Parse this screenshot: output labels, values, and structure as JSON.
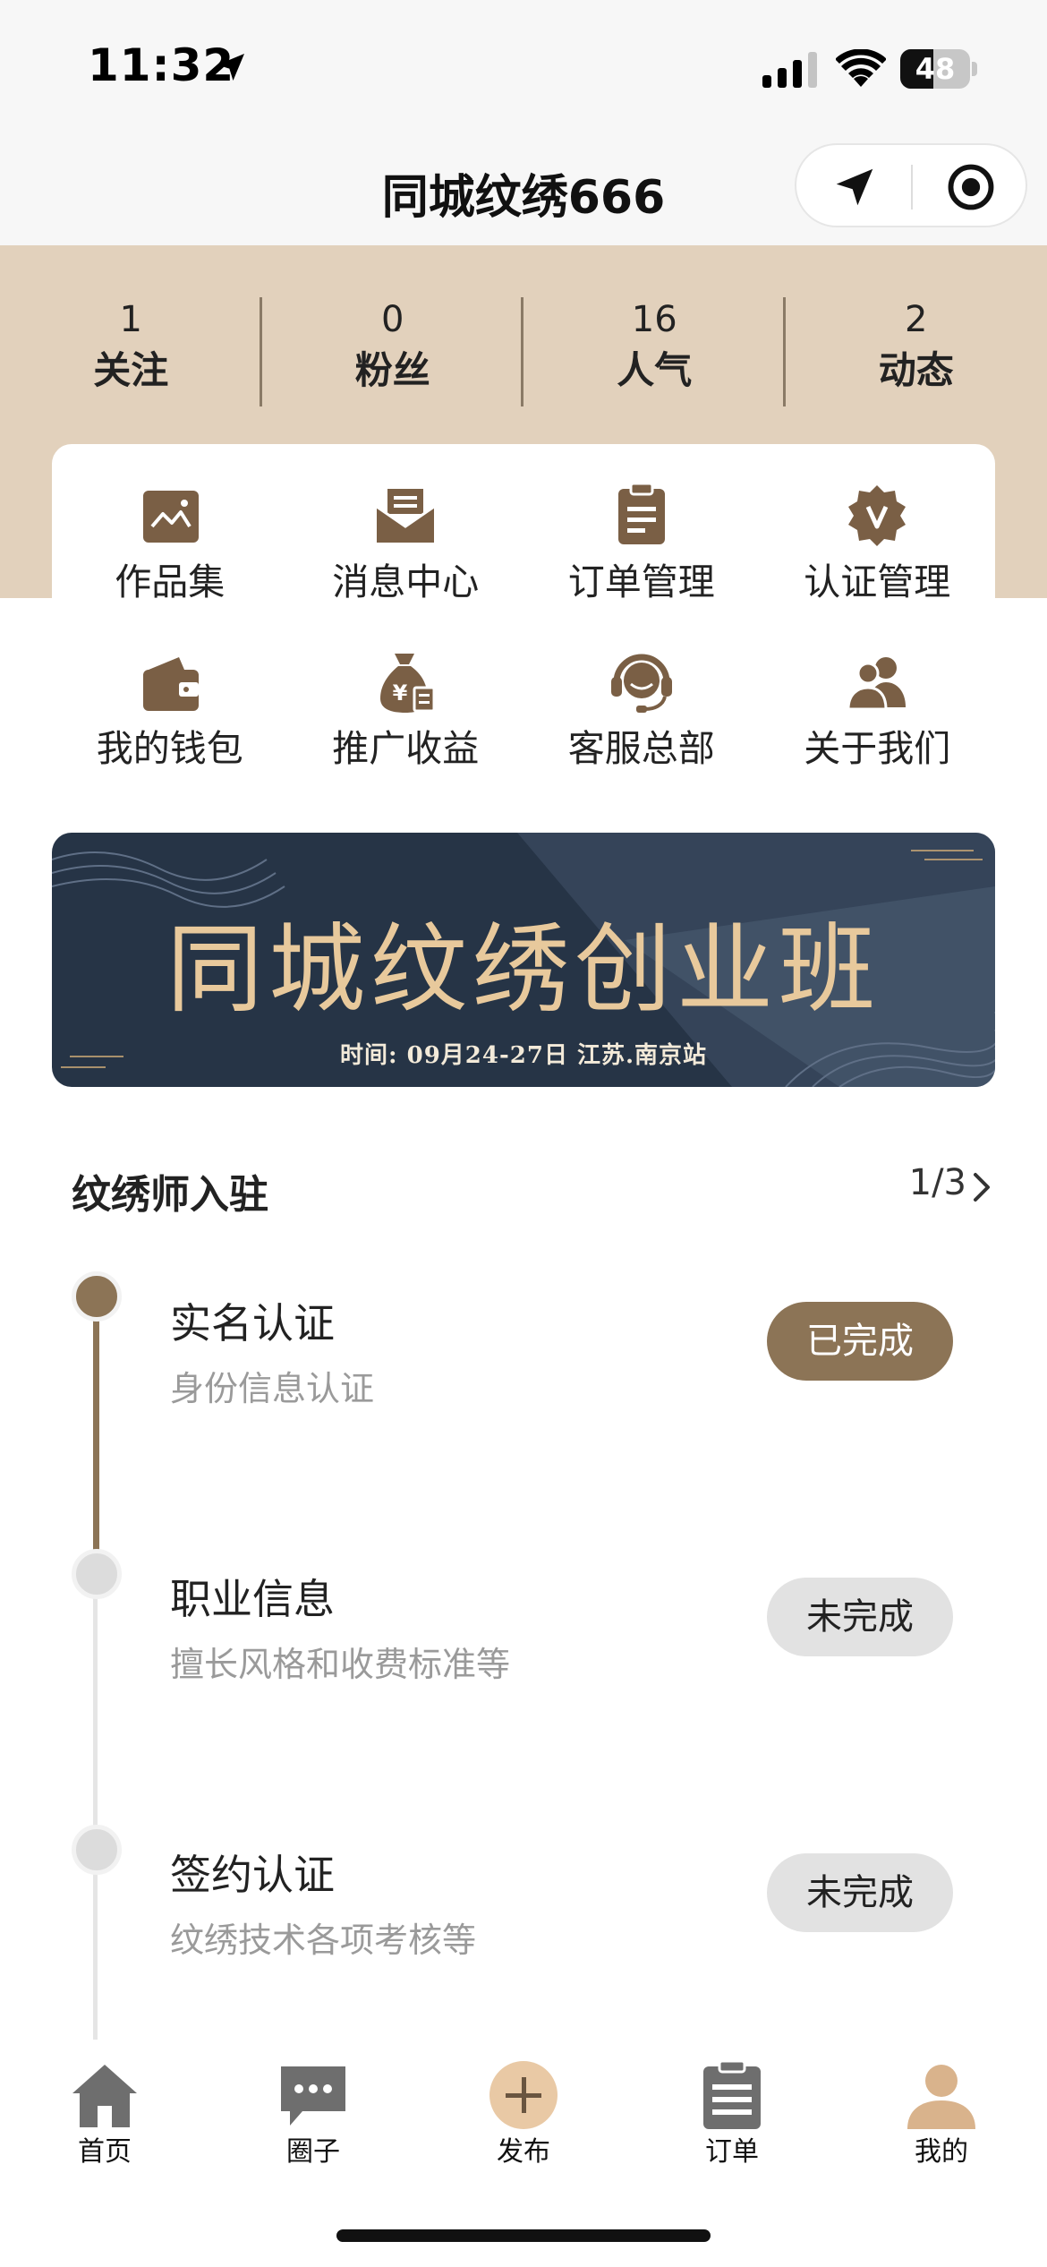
{
  "status_bar": {
    "time": "11:32",
    "battery": "48",
    "battery_level": 0.48,
    "icons": [
      "location-arrow-icon",
      "signal-icon",
      "wifi-icon",
      "battery-icon"
    ]
  },
  "nav": {
    "title": "同城纹绣666",
    "capsule_icons": [
      "navigation-arrow-icon",
      "target-circle-icon"
    ]
  },
  "stats": [
    {
      "count": "1",
      "label": "关注"
    },
    {
      "count": "0",
      "label": "粉丝"
    },
    {
      "count": "16",
      "label": "人气"
    },
    {
      "count": "2",
      "label": "动态"
    }
  ],
  "menu": [
    {
      "label": "作品集",
      "icon": "image-gallery-icon"
    },
    {
      "label": "消息中心",
      "icon": "envelope-icon"
    },
    {
      "label": "订单管理",
      "icon": "clipboard-icon"
    },
    {
      "label": "认证管理",
      "icon": "verified-badge-icon"
    },
    {
      "label": "我的钱包",
      "icon": "wallet-icon"
    },
    {
      "label": "推广收益",
      "icon": "money-bag-icon"
    },
    {
      "label": "客服总部",
      "icon": "headset-icon"
    },
    {
      "label": "关于我们",
      "icon": "users-icon"
    }
  ],
  "banner": {
    "title": "同城纹绣创业班",
    "subtitle": "时间: 09月24-27日  江苏.南京站"
  },
  "onboarding": {
    "title": "纹绣师入驻",
    "page": "1/3",
    "steps": [
      {
        "title": "实名认证",
        "desc": "身份信息认证",
        "status": "已完成",
        "done": true
      },
      {
        "title": "职业信息",
        "desc": "擅长风格和收费标准等",
        "status": "未完成",
        "done": false
      },
      {
        "title": "签约认证",
        "desc": "纹绣技术各项考核等",
        "status": "未完成",
        "done": false
      }
    ]
  },
  "tabs": [
    {
      "label": "首页",
      "icon": "home-icon"
    },
    {
      "label": "圈子",
      "icon": "chat-bubble-icon"
    },
    {
      "label": "发布",
      "icon": "plus-circle-icon"
    },
    {
      "label": "订单",
      "icon": "order-list-icon"
    },
    {
      "label": "我的",
      "icon": "user-profile-icon"
    }
  ],
  "colors": {
    "accent": "#8c7456",
    "header_band": "#e2d1bc",
    "icon": "#7a5f45",
    "banner_bg": "#263446",
    "banner_title": "#e8c99c",
    "tab_icon": "#6e6e6e",
    "tab_active": "#d9b38c"
  }
}
